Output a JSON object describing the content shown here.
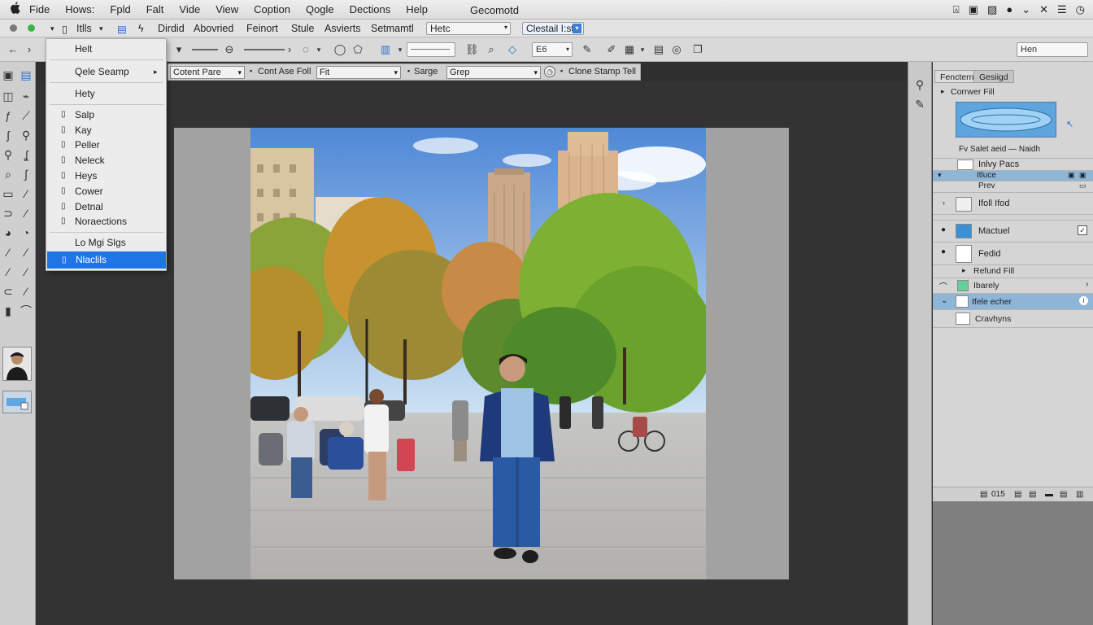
{
  "menubar": {
    "apple": "",
    "items": [
      "Fide",
      "Hows:",
      "Fpld",
      "Falt",
      "Vide",
      "View",
      "Coption",
      "Qogle",
      "Dections",
      "Help"
    ],
    "window_title": "Gecomotd"
  },
  "toolbar1": {
    "doc_label": "Itlls",
    "items": [
      "Dirdid",
      "Abovried",
      "Feinort",
      "Stule",
      "Asvierts",
      "Setmamtl",
      "Hetc"
    ],
    "dropdown_value": "Clestail I:st"
  },
  "toolbar2": {
    "field1": "E6",
    "search_value": "Hen"
  },
  "options_bar": {
    "mode_value": "Cotent Pare",
    "label1": "Cont Ase Foll",
    "fill_value": "Fit",
    "label2": "Sarge",
    "sample_value": "Grep",
    "label3": "Clone Stamp Tell"
  },
  "dropdown_menu": {
    "items": [
      {
        "label": "Helt",
        "icon": "",
        "arrow": ""
      },
      {
        "label": "Qele Seamp",
        "icon": "",
        "arrow": "▸"
      },
      {
        "label": "Hety",
        "icon": "",
        "arrow": ""
      },
      {
        "label": "Salp",
        "icon": "▯",
        "arrow": ""
      },
      {
        "label": "Kay",
        "icon": "▯",
        "arrow": ""
      },
      {
        "label": "Peller",
        "icon": "▯",
        "arrow": ""
      },
      {
        "label": "Neleck",
        "icon": "▯",
        "arrow": ""
      },
      {
        "label": "Heys",
        "icon": "▯",
        "arrow": ""
      },
      {
        "label": "Cower",
        "icon": "▯",
        "arrow": ""
      },
      {
        "label": "Detnal",
        "icon": "▯",
        "arrow": ""
      },
      {
        "label": "Noraections",
        "icon": "▯",
        "arrow": ""
      },
      {
        "label": "Lo Mgi Slgs",
        "icon": "",
        "arrow": ""
      },
      {
        "label": "Nlaclils",
        "icon": "▯",
        "arrow": "",
        "selected": true
      }
    ]
  },
  "panel": {
    "tabs": [
      "Fenctern",
      "Gesiigd"
    ],
    "section_label": "Corrwer Fill",
    "subtitle": "Fv Salet aeid — Naidh",
    "rows": [
      {
        "label": "Inlvy Pacs"
      },
      {
        "label": "Itluce"
      },
      {
        "label": "Prev"
      },
      {
        "label": "Ifoll Ifod"
      },
      {
        "label": "Mactuel"
      },
      {
        "label": "Fedid"
      },
      {
        "label": "Refund Fill"
      },
      {
        "label": "Ibarely"
      },
      {
        "label": "Ifele echer"
      },
      {
        "label": "Cravhyns"
      }
    ],
    "footer": "015"
  },
  "colors": {
    "accent": "#1f74e6",
    "panel_selected": "#8eb6d8",
    "canvas_bg": "#333333"
  }
}
